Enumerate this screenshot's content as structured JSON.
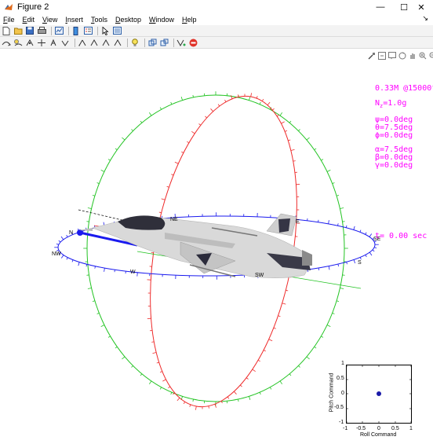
{
  "window": {
    "title": "Figure 2",
    "controls": {
      "minimize": "—",
      "maximize": "☐",
      "close": "✕"
    }
  },
  "menu": {
    "items": [
      {
        "label": "File",
        "mnemonic": "F",
        "rest": "ile"
      },
      {
        "label": "Edit",
        "mnemonic": "E",
        "rest": "dit"
      },
      {
        "label": "View",
        "mnemonic": "V",
        "rest": "iew"
      },
      {
        "label": "Insert",
        "mnemonic": "I",
        "rest": "nsert"
      },
      {
        "label": "Tools",
        "mnemonic": "T",
        "rest": "ools"
      },
      {
        "label": "Desktop",
        "mnemonic": "D",
        "rest": "esktop"
      },
      {
        "label": "Window",
        "mnemonic": "W",
        "rest": "indow"
      },
      {
        "label": "Help",
        "mnemonic": "H",
        "rest": "elp"
      }
    ],
    "pin": "↘"
  },
  "toolbar1": [
    "new-figure-icon",
    "open-file-icon",
    "save-icon",
    "print-icon",
    "print-preview-icon",
    "link-plot-icon",
    "insert-colorbar-icon",
    "pointer-arrow-icon",
    "property-inspector-icon"
  ],
  "toolbar2": [
    "rotate-icon",
    "zoom-icon",
    "pan-icon",
    "data-cursor-icon",
    "brush-icon",
    "rotate-3d-icon",
    "zoom-in-icon",
    "zoom-out-icon",
    "pan-hand-icon",
    "data-tip-icon",
    "light-bulb-icon",
    "camera-icon",
    "plot-tools-icon",
    "edit-plot-icon",
    "stop-icon"
  ],
  "axes_toolbar": [
    "brush-axes-icon",
    "export-axes-icon",
    "data-tips-icon",
    "rotate-axes-icon",
    "pan-axes-icon",
    "zoom-in-axes-icon",
    "zoom-out-axes-icon",
    "home-axes-icon"
  ],
  "readout": {
    "mach_alt": "0.33M @15000ft",
    "nz_label": "N",
    "nz_sub": "z",
    "nz_value": "=1.0g",
    "psi": "ψ=0.0deg",
    "theta": "θ=7.5deg",
    "phi": "ϕ=0.0deg",
    "alpha": "α=7.5deg",
    "beta": "β=0.0deg",
    "gamma": "γ=0.0deg",
    "time": "t= 0.00 sec"
  },
  "compass": {
    "N": "N",
    "NE": "NE",
    "E": "E",
    "SE": "SE",
    "S": "S",
    "SW": "SW",
    "W": "W",
    "NW": "NW"
  },
  "colors": {
    "readout": "#ff00ff",
    "green_ring": "#22c322",
    "red_ring": "#ee2a2a",
    "blue_ring": "#1a1aee"
  },
  "inset": {
    "ylabel": "Pitch Command",
    "xlabel": "Roll Command",
    "xticks": [
      "-1",
      "-0.5",
      "0",
      "0.5",
      "1"
    ],
    "yticks": [
      "1",
      "0.5",
      "0",
      "-0.5",
      "-1"
    ],
    "point": {
      "x": 0,
      "y": 0
    }
  }
}
